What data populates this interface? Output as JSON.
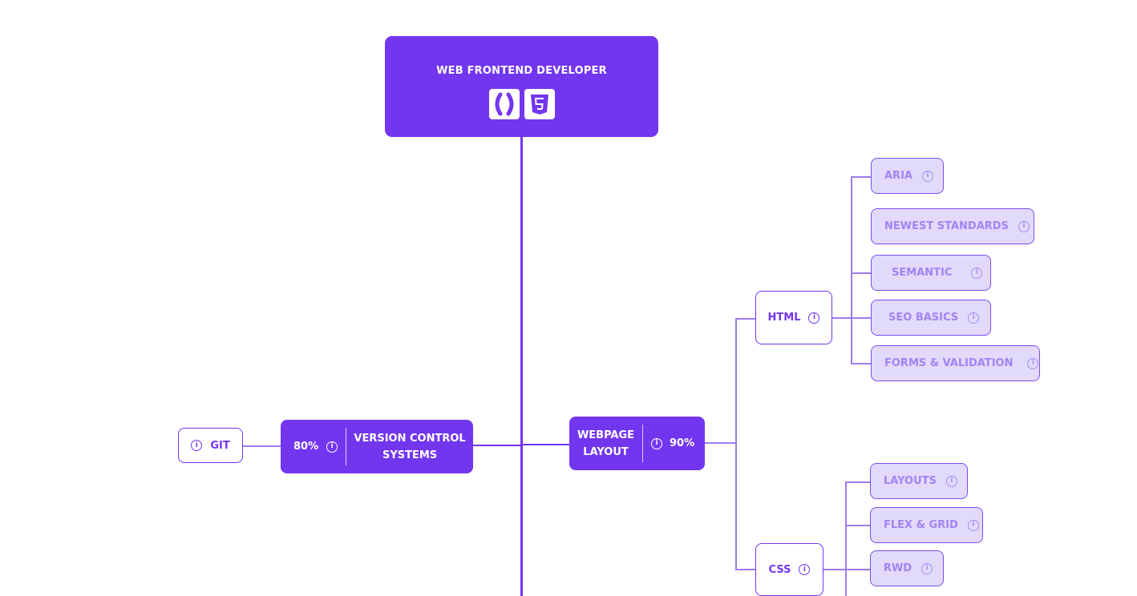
{
  "root": {
    "title": "WEB FRONTEND DEVELOPER",
    "icons": [
      "brackets-icon",
      "html5-icon"
    ]
  },
  "nodes": {
    "version_control": {
      "label_line1": "VERSION CONTROL",
      "label_line2": "SYSTEMS",
      "percent": "80%"
    },
    "git": {
      "label": "GIT"
    },
    "webpage_layout": {
      "label_line1": "WEBPAGE",
      "label_line2": "LAYOUT",
      "percent": "90%"
    },
    "html": {
      "label": "HTML"
    },
    "css": {
      "label": "CSS"
    }
  },
  "html_children": [
    "ARIA",
    "NEWEST STANDARDS",
    "SEMANTIC",
    "SEO BASICS",
    "FORMS & VALIDATION"
  ],
  "css_children": [
    "LAYOUTS",
    "FLEX & GRID",
    "RWD"
  ],
  "info_glyph": "i",
  "colors": {
    "primary": "#7336ef",
    "leaf_bg": "#e1dafa",
    "leaf_text": "#9f85f3",
    "connector": "#9c7cf0"
  }
}
